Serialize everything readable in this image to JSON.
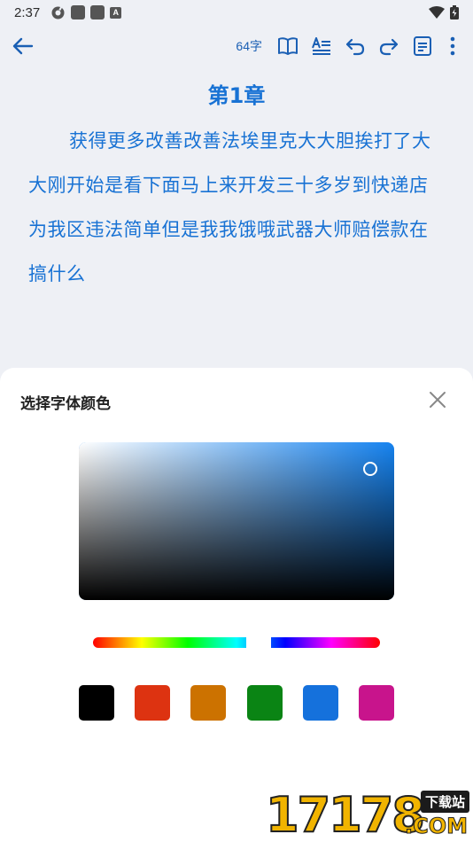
{
  "status_bar": {
    "time": "2:37"
  },
  "toolbar": {
    "word_count": "64字",
    "icons": [
      "back-arrow-icon",
      "book-icon",
      "text-format-icon",
      "undo-icon",
      "redo-icon",
      "note-icon",
      "more-vert-icon"
    ]
  },
  "content": {
    "chapter_title": "第1章",
    "body": "获得更多改善改善法埃里克大大胆挨打了大大刚开始是看下面马上来开发三十多岁到快递店为我区违法简单但是我我饿哦武器大师赔偿款在搞什么"
  },
  "color_sheet": {
    "title": "选择字体颜色",
    "selected_hue_color": "#1683f0",
    "swatches": [
      {
        "name": "black",
        "color": "#000000"
      },
      {
        "name": "red",
        "color": "#dd3311"
      },
      {
        "name": "orange",
        "color": "#cc7200"
      },
      {
        "name": "green",
        "color": "#0a8414"
      },
      {
        "name": "blue",
        "color": "#1571dc"
      },
      {
        "name": "magenta",
        "color": "#c8148c"
      }
    ]
  },
  "colors": {
    "accent": "#1872d4",
    "background": "#eef0f5",
    "sheet": "#ffffff"
  },
  "watermark": {
    "digits": "17178",
    "tag": "下载站",
    "suffix": ".COM"
  }
}
